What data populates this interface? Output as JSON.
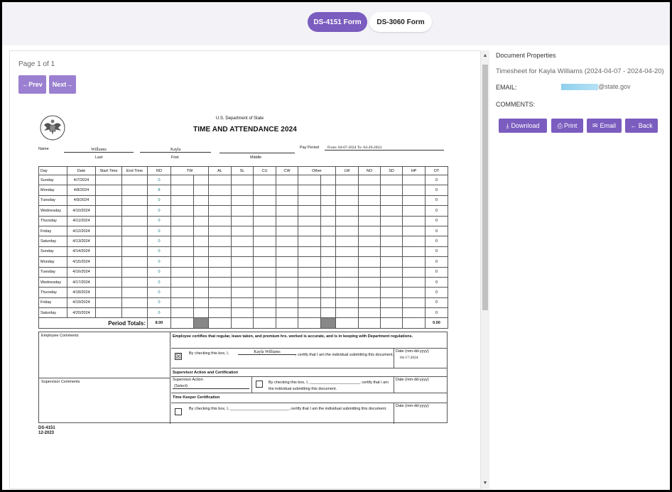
{
  "tabs": [
    {
      "label": "DS-4151 Form",
      "active": true
    },
    {
      "label": "DS-3060 Form",
      "active": false
    }
  ],
  "viewer": {
    "page_info": "Page 1 of 1",
    "prev_label": "←Prev",
    "next_label": "Next→"
  },
  "form": {
    "department": "U.S. Department of State",
    "title": "TIME AND ATTENDANCE 2024",
    "name_label": "Name",
    "last_name": "Williams",
    "first_name": "Kayla",
    "middle_name": "",
    "last_caption": "Last",
    "first_caption": "First",
    "middle_caption": "Middle",
    "pay_period_label": "Pay Period",
    "pay_period_value": "From: 04-07-2024   To: 04-20-2024",
    "columns": [
      "Day",
      "Date",
      "Start Time",
      "End Time",
      "RD",
      "TW",
      "AL",
      "SL",
      "CU",
      "CW",
      "Other",
      "LW",
      "NO",
      "SD",
      "HP",
      "OT"
    ],
    "rows": [
      {
        "day": "Sunday",
        "date": "4/7/2024",
        "rd": "0",
        "ot": "0"
      },
      {
        "day": "Monday",
        "date": "4/8/2024",
        "rd": "8",
        "ot": "0"
      },
      {
        "day": "Tuesday",
        "date": "4/9/2024",
        "rd": "0",
        "ot": "0"
      },
      {
        "day": "Wednesday",
        "date": "4/10/2024",
        "rd": "0",
        "ot": "0"
      },
      {
        "day": "Thursday",
        "date": "4/11/2024",
        "rd": "0",
        "ot": "0"
      },
      {
        "day": "Friday",
        "date": "4/12/2024",
        "rd": "0",
        "ot": "0"
      },
      {
        "day": "Saturday",
        "date": "4/13/2024",
        "rd": "0",
        "ot": "0"
      },
      {
        "day": "Sunday",
        "date": "4/14/2024",
        "rd": "0",
        "ot": "0"
      },
      {
        "day": "Monday",
        "date": "4/15/2024",
        "rd": "0",
        "ot": "0"
      },
      {
        "day": "Tuesday",
        "date": "4/16/2024",
        "rd": "0",
        "ot": "0"
      },
      {
        "day": "Wednesday",
        "date": "4/17/2024",
        "rd": "0",
        "ot": "0"
      },
      {
        "day": "Thursday",
        "date": "4/18/2024",
        "rd": "0",
        "ot": "0"
      },
      {
        "day": "Friday",
        "date": "4/19/2024",
        "rd": "0",
        "ot": "0"
      },
      {
        "day": "Saturday",
        "date": "4/20/2024",
        "rd": "0",
        "ot": "0"
      }
    ],
    "period_totals_label": "Period Totals:",
    "rd_total": "8.00",
    "ot_total": "0.00",
    "employee_comments_label": "Employee Comments",
    "supervisor_comments_label": "Supervisor Comments",
    "certify_text": "Employee certifies that regular, leave taken, and premium hrs. worked is accurate, and is in keeping with Department regulations.",
    "by_checking_prefix": "By checking this box, I,",
    "employee_sig_name": "Kayla Williams",
    "certify_suffix": ", certify that I am the individual submitting this document.",
    "date_label": "Date (mm-dd-yyyy)",
    "employee_date": "04-17-2024",
    "supervisor_section_title": "Supervisor Action and Certification",
    "supervisor_action_label": "Supervisor Action",
    "supervisor_action_value": "(Select)",
    "timekeeper_section_title": "Time Keeper Certification",
    "form_number": "DS-4151",
    "form_date": "12-2023"
  },
  "panel": {
    "title": "Document Properties",
    "doc_name": "Timesheet for Kayla Williams (2024-04-07 - 2024-04-20)",
    "email_label": "EMAIL:",
    "email_domain": "@state.gov",
    "comments_label": "COMMENTS:",
    "download_label": "Download",
    "print_label": "Print",
    "email_button_label": "Email",
    "back_label": "← Back"
  },
  "colors": {
    "accent": "#7b5cbf",
    "accent_light": "#9b7fd0",
    "teal_values": "#167a80"
  }
}
